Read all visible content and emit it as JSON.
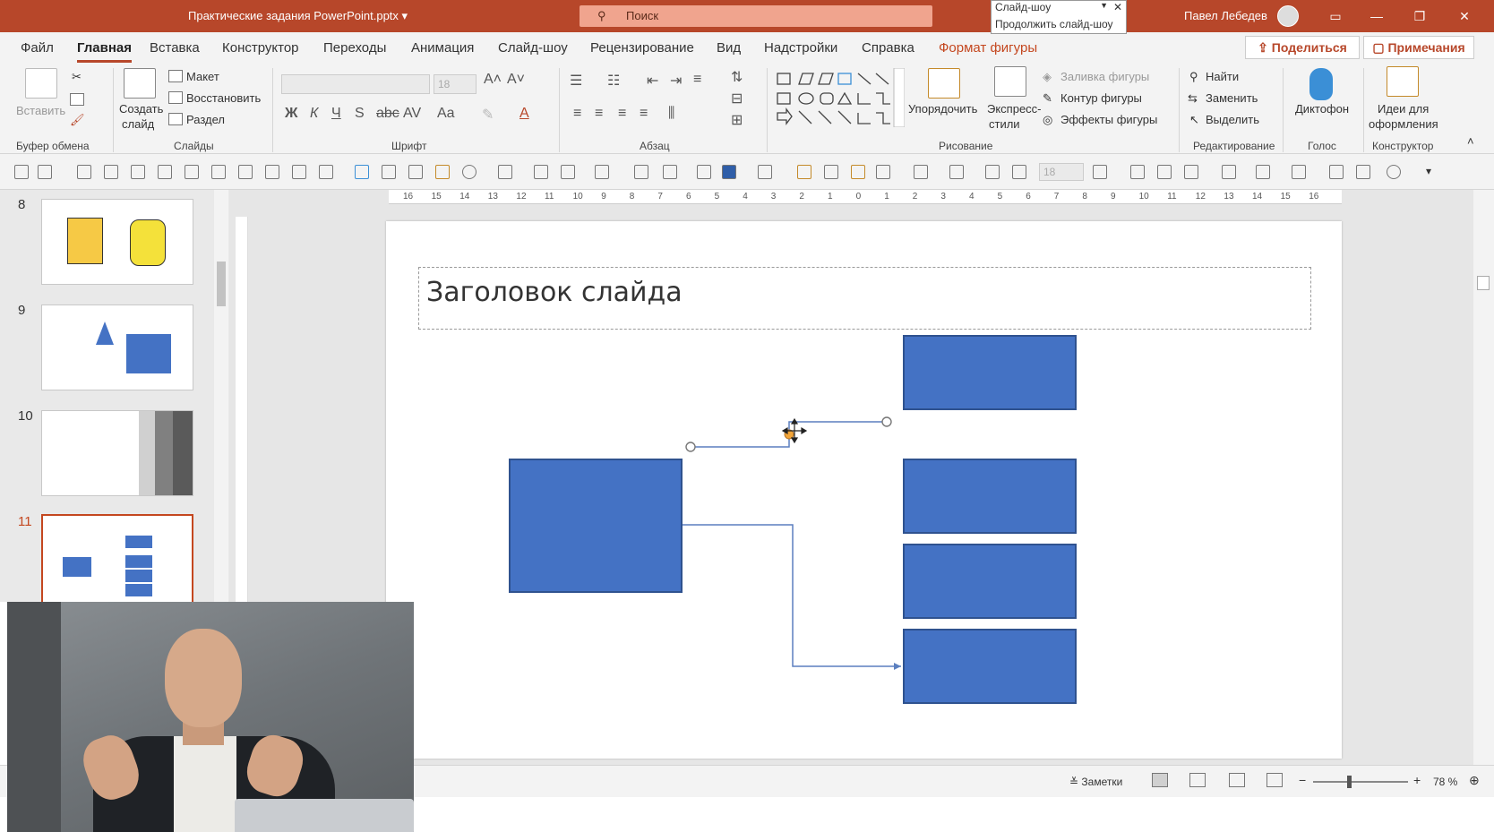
{
  "titlebar": {
    "doc_title": "Практические задания PowerPoint.pptx",
    "search_placeholder": "Поиск",
    "user_name": "Павел Лебедев",
    "popup_title": "Слайд-шоу",
    "popup_item": "Продолжить слайд-шоу"
  },
  "tabs": [
    "Файл",
    "Главная",
    "Вставка",
    "Конструктор",
    "Переходы",
    "Анимация",
    "Слайд-шоу",
    "Рецензирование",
    "Вид",
    "Надстройки",
    "Справка",
    "Формат фигуры"
  ],
  "share_label": "Поделиться",
  "comments_label": "Примечания",
  "ribbon": {
    "clipboard": {
      "paste": "Вставить",
      "group": "Буфер обмена"
    },
    "slides": {
      "create_1": "Создать",
      "create_2": "слайд",
      "layout": "Макет",
      "reset": "Восстановить",
      "section": "Раздел",
      "group": "Слайды"
    },
    "font": {
      "size": "18",
      "group": "Шрифт"
    },
    "paragraph": {
      "group": "Абзац"
    },
    "drawing": {
      "arrange": "Упорядочить",
      "quick_1": "Экспресс-",
      "quick_2": "стили",
      "fill": "Заливка фигуры",
      "outline": "Контур фигуры",
      "effects": "Эффекты фигуры",
      "group": "Рисование"
    },
    "editing": {
      "find": "Найти",
      "replace": "Заменить",
      "select": "Выделить",
      "group": "Редактирование"
    },
    "voice": {
      "dictate": "Диктофон",
      "group": "Голос"
    },
    "designer": {
      "ideas_1": "Идеи для",
      "ideas_2": "оформления",
      "group": "Конструктор"
    }
  },
  "qat_size": "18",
  "thumbnails": [
    {
      "num": "8"
    },
    {
      "num": "9"
    },
    {
      "num": "10"
    },
    {
      "num": "11"
    }
  ],
  "ruler_labels": [
    "16",
    "15",
    "14",
    "13",
    "12",
    "11",
    "10",
    "9",
    "8",
    "7",
    "6",
    "5",
    "4",
    "3",
    "2",
    "1",
    "0",
    "1",
    "2",
    "3",
    "4",
    "5",
    "6",
    "7",
    "8",
    "9",
    "10",
    "11",
    "12",
    "13",
    "14",
    "15",
    "16"
  ],
  "slide": {
    "title": "Заголовок слайда"
  },
  "statusbar": {
    "notes": "Заметки",
    "zoom": "78 %"
  },
  "colors": {
    "accent": "#b7472a",
    "shape_fill": "#4472c4",
    "shape_border": "#2f528f",
    "connector": "#5b7fbf"
  }
}
